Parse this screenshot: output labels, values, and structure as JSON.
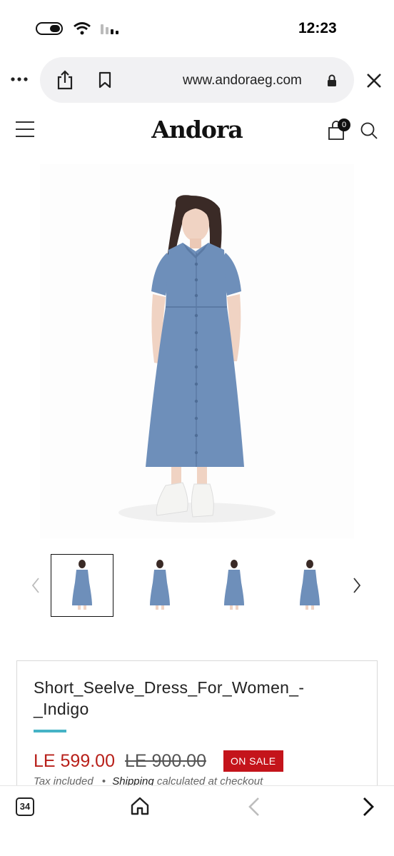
{
  "status_bar": {
    "time": "12:23"
  },
  "browser": {
    "url": "www.andoraeg.com",
    "tab_count": "34"
  },
  "site": {
    "logo": "Andora",
    "cart_count": "0"
  },
  "product": {
    "title": "Short_Seelve_Dress_For_Women_-_Indigo",
    "sale_price": "LE 599.00",
    "compare_price": "LE 900.00",
    "badge": "ON SALE",
    "tax_text": "Tax included",
    "bullet": "•",
    "shipping_link": "Shipping",
    "shipping_text": "calculated at checkout"
  },
  "colors": {
    "accent_underline": "#46b3c6",
    "sale_red": "#c4141b",
    "dress_blue": "#6e8fba"
  },
  "icons": {
    "status": [
      "battery-icon",
      "wifi-icon",
      "signal-icon"
    ],
    "browser": [
      "more-icon",
      "share-icon",
      "bookmark-icon",
      "lock-icon",
      "close-icon"
    ],
    "header": [
      "menu-icon",
      "cart-icon",
      "search-icon"
    ],
    "toolbar": [
      "tabs-icon",
      "home-icon",
      "back-icon",
      "forward-icon"
    ]
  }
}
